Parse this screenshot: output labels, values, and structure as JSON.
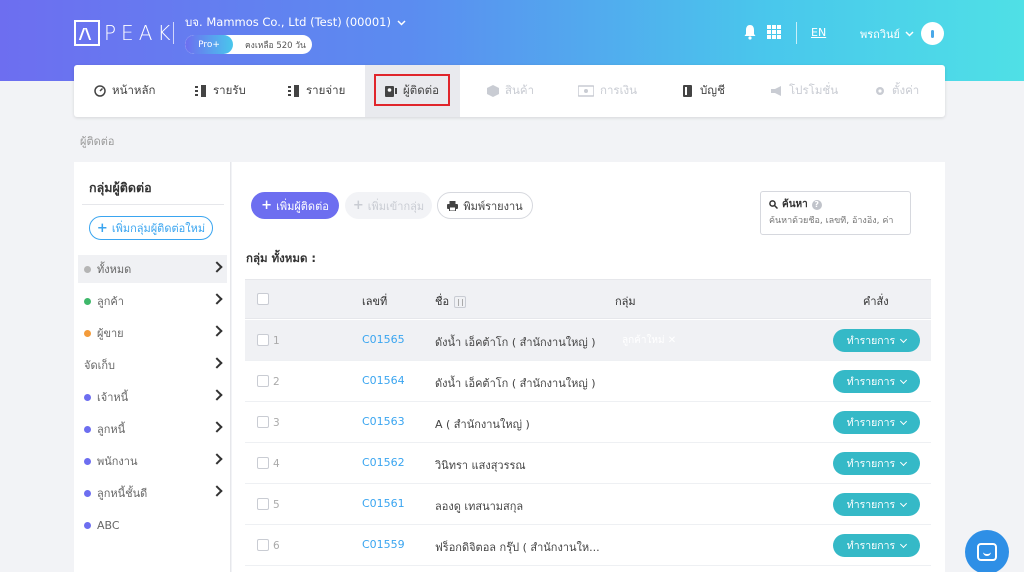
{
  "header": {
    "logo_text": "PEAK",
    "company": "บจ. Mammos Co., Ltd (Test) (00001)",
    "plan_badge": "Pro+",
    "plan_remaining": "คงเหลือ 520 วัน",
    "language": "EN",
    "user_name": "พรถวินย์",
    "gradient": [
      "#6d6ef0",
      "#49c7ec"
    ]
  },
  "nav": {
    "items": [
      {
        "label": "หน้าหลัก",
        "icon": "dashboard-icon",
        "enabled": true
      },
      {
        "label": "รายรับ",
        "icon": "income-icon",
        "enabled": true
      },
      {
        "label": "รายจ่าย",
        "icon": "expense-icon",
        "enabled": true
      },
      {
        "label": "ผู้ติดต่อ",
        "icon": "contact-icon",
        "enabled": true,
        "active": true
      },
      {
        "label": "สินค้า",
        "icon": "product-icon",
        "enabled": false
      },
      {
        "label": "การเงิน",
        "icon": "finance-icon",
        "enabled": false
      },
      {
        "label": "บัญชี",
        "icon": "accounting-icon",
        "enabled": true
      },
      {
        "label": "โปรโมชั่น",
        "icon": "megaphone-icon",
        "enabled": false
      },
      {
        "label": "ตั้งค่า",
        "icon": "gear-icon",
        "enabled": false
      }
    ]
  },
  "breadcrumb": "ผู้ติดต่อ",
  "sidebar": {
    "title": "กลุ่มผู้ติดต่อ",
    "add_group_label": "เพิ่มกลุ่มผู้ติดต่อใหม่",
    "items": [
      {
        "label": "ทั้งหมด",
        "color": "#b5b5b5"
      },
      {
        "label": "ลูกค้า",
        "color": "#3fb86b"
      },
      {
        "label": "ผู้ขาย",
        "color": "#f39b3a"
      },
      {
        "label": "จัดเก็บ",
        "color": ""
      },
      {
        "label": "เจ้าหนี้",
        "color": "#6d6ef0"
      },
      {
        "label": "ลูกหนี้",
        "color": "#6d6ef0"
      },
      {
        "label": "พนักงาน",
        "color": "#6d6ef0"
      },
      {
        "label": "ลูกหนี้ชั้นดี",
        "color": "#6d6ef0"
      },
      {
        "label": "ABC",
        "color": "#6d6ef0"
      }
    ]
  },
  "toolbar": {
    "add_contact": "เพิ่มผู้ติดต่อ",
    "add_to_group": "เพิ่มเข้ากลุ่ม",
    "print_report": "พิมพ์รายงาน",
    "search_label": "ค้นหา",
    "search_placeholder": "ค้นหาด้วยชื่อ, เลขที่, อ้างอิง, ค่า"
  },
  "group_label": "กลุ่ม ทั้งหมด :",
  "table": {
    "headers": {
      "number": "เลขที่",
      "name": "ชื่อ",
      "group": "กลุ่ม",
      "action": "คำสั่ง"
    },
    "rows": [
      {
        "index": "1",
        "code": "C01565",
        "name": "ดังน้ำ เอ็คต้าโก ( สำนักงานใหญ่ )",
        "group": "ลูกค้าใหม่",
        "action": "ทำรายการ"
      },
      {
        "index": "2",
        "code": "C01564",
        "name": "ดังน้ำ เอ็คต้าโก ( สำนักงานใหญ่ )",
        "group": "",
        "action": "ทำรายการ"
      },
      {
        "index": "3",
        "code": "C01563",
        "name": "A ( สำนักงานใหญ่ )",
        "group": "",
        "action": "ทำรายการ"
      },
      {
        "index": "4",
        "code": "C01562",
        "name": "วินิทรา แสงสุวรรณ",
        "group": "",
        "action": "ทำรายการ"
      },
      {
        "index": "5",
        "code": "C01561",
        "name": "ลองดู เทสนามสกุล",
        "group": "",
        "action": "ทำรายการ"
      },
      {
        "index": "6",
        "code": "C01559",
        "name": "ฟร็อกดิจิตอล กรุ๊ป ( สำนักงานให...",
        "group": "",
        "action": "ทำรายการ"
      }
    ]
  },
  "colors": {
    "primary": "#6d6ef0",
    "teal": "#35b9c7",
    "link": "#3aa5f0",
    "highlight": "#e0252b"
  }
}
